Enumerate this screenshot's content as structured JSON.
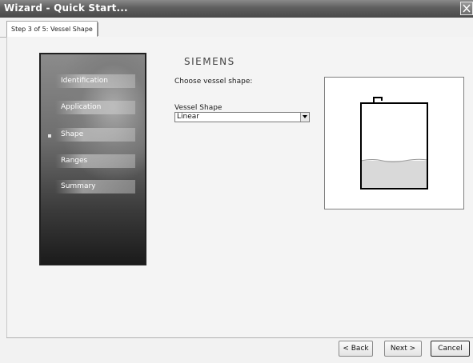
{
  "window": {
    "title": "Wizard - Quick Start...",
    "close_glyph": "close-icon"
  },
  "tab": {
    "label": "Step 3 of 5: Vessel Shape"
  },
  "nav": {
    "items": [
      {
        "label": "Identification"
      },
      {
        "label": "Application"
      },
      {
        "label": "Shape"
      },
      {
        "label": "Ranges"
      },
      {
        "label": "Summary"
      }
    ],
    "active_index": 2
  },
  "content": {
    "brand": "SIEMENS",
    "prompt": "Choose vessel shape:",
    "vessel_shape": {
      "label": "Vessel Shape",
      "value": "Linear"
    }
  },
  "preview": {
    "shape": "Linear"
  },
  "buttons": {
    "back": "< Back",
    "next": "Next >",
    "cancel": "Cancel"
  }
}
